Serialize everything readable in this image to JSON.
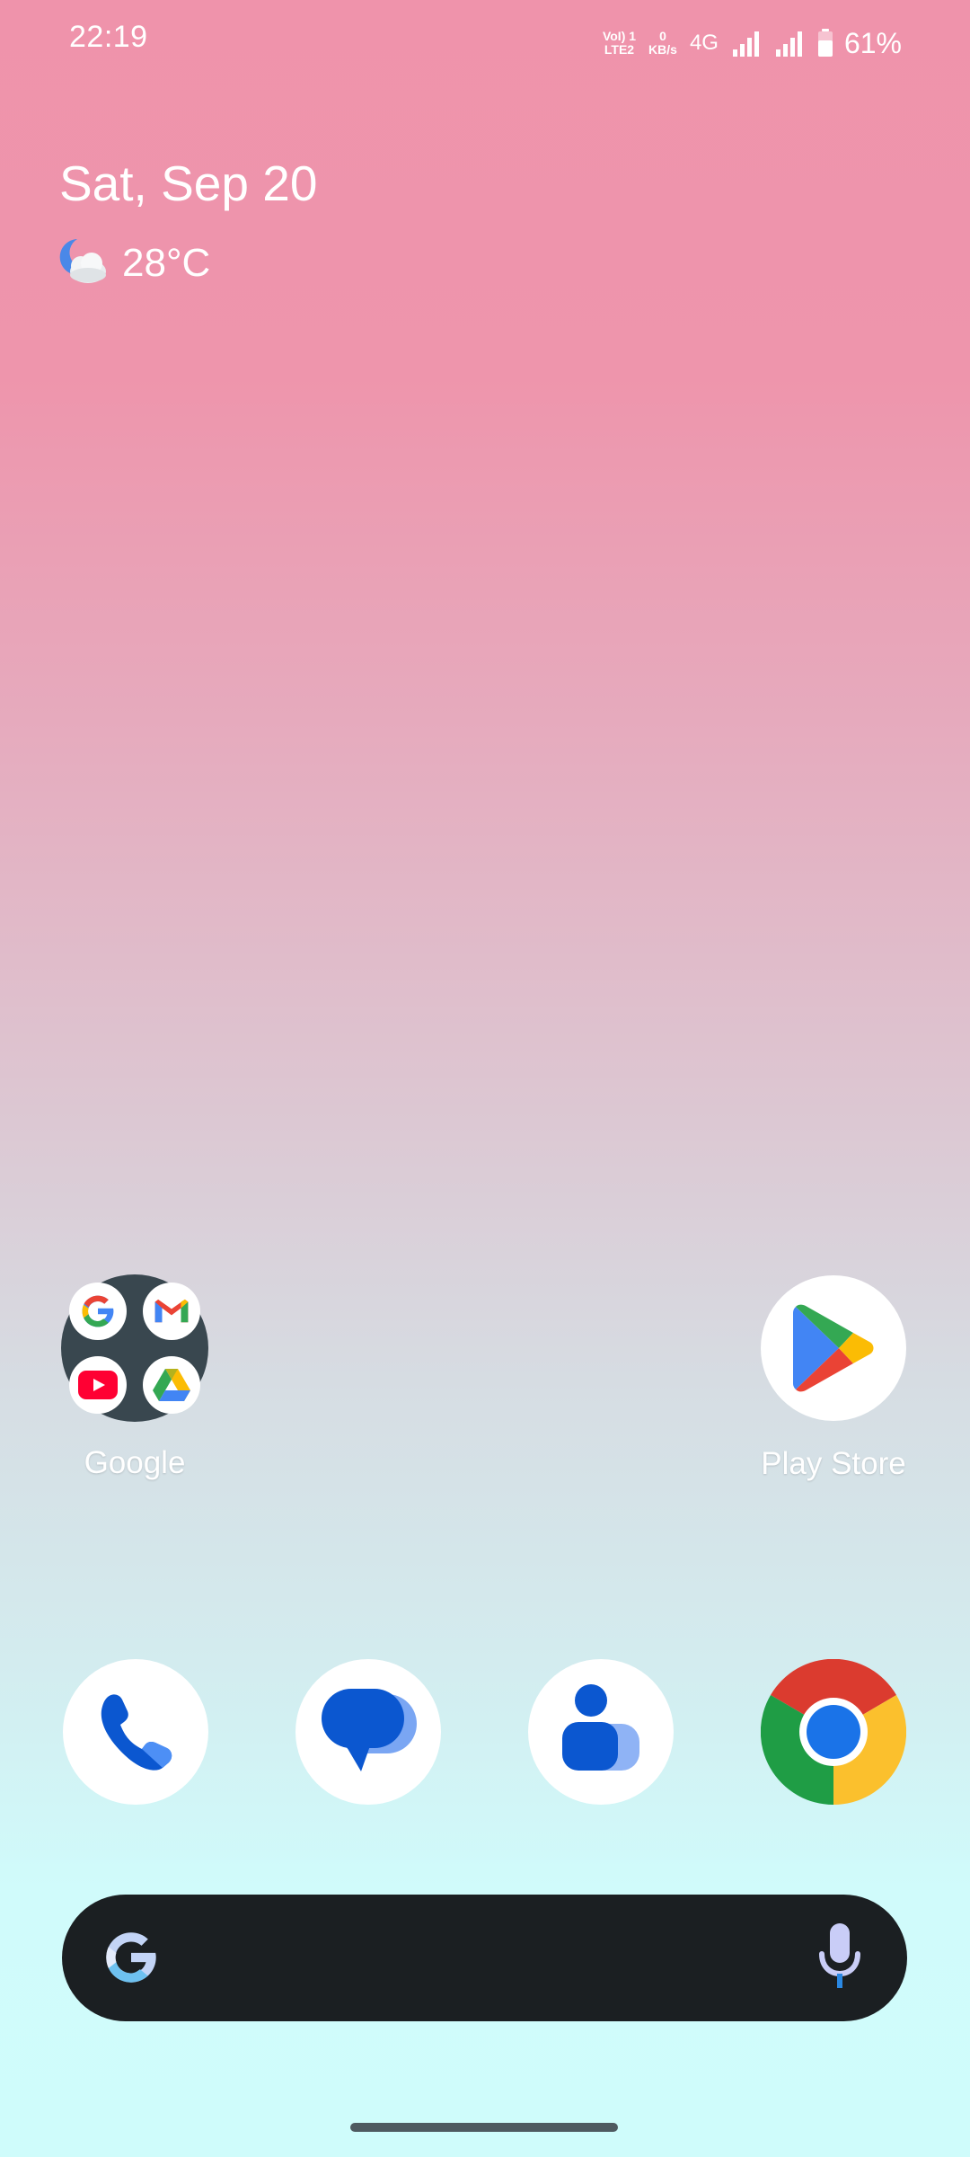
{
  "status_bar": {
    "time": "22:19",
    "volte_line1": "VoI) 1",
    "volte_line2": "LTE2",
    "speed_value": "0",
    "speed_unit": "KB/s",
    "network": "4G",
    "battery_percent": "61%",
    "battery_level": 0.61
  },
  "widget": {
    "date": "Sat, Sep 20",
    "weather_icon": "partly-cloudy-night-icon",
    "temperature": "28°C"
  },
  "home_apps": [
    {
      "label": "Google",
      "type": "folder",
      "contents": [
        "google-search-icon",
        "gmail-icon",
        "youtube-icon",
        "google-drive-icon"
      ]
    },
    {
      "label": "Play Store",
      "icon": "play-store-icon"
    }
  ],
  "dock": [
    {
      "icon": "phone-icon"
    },
    {
      "icon": "messages-icon"
    },
    {
      "icon": "contacts-icon"
    },
    {
      "icon": "chrome-icon"
    }
  ],
  "search_bar": {
    "logo": "google-g-icon",
    "mic": "microphone-icon"
  },
  "colors": {
    "wallpaper_top": "#ef93ab",
    "wallpaper_bottom": "#cffcfb",
    "search_bar_bg": "#1b1f22",
    "folder_bg": "#39474f",
    "google_blue": "#4285F4",
    "google_red": "#EA4335",
    "google_yellow": "#FBBC04",
    "google_green": "#34A853"
  }
}
